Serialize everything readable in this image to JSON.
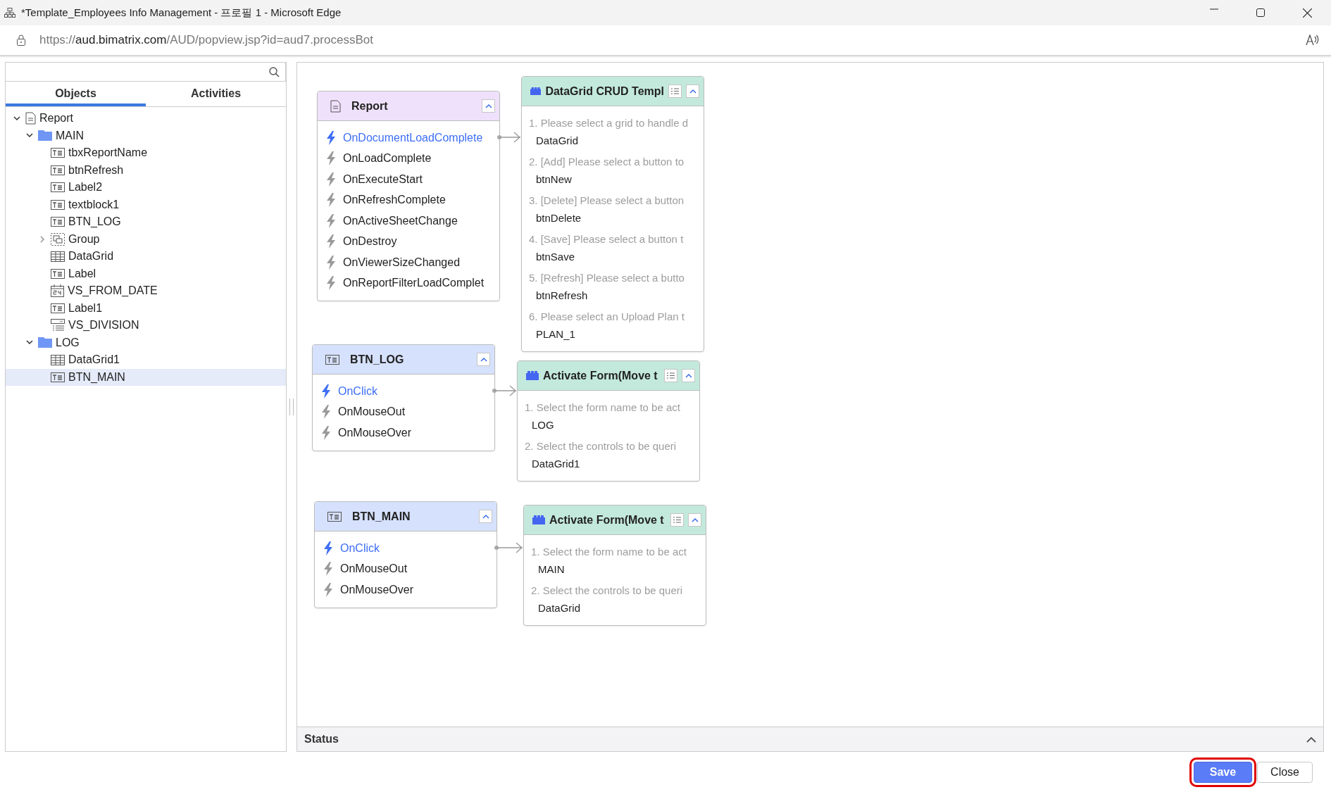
{
  "window": {
    "title": "*Template_Employees Info Management - 프로필 1 - Microsoft Edge"
  },
  "address_bar": {
    "url": "https://**aud.bimatrix.com**/AUD/popview.jsp?id=aud7.processBot"
  },
  "sidebar": {
    "tabs": [
      {
        "label": "Objects",
        "selected": true
      },
      {
        "label": "Activities",
        "selected": false
      }
    ],
    "tree": [
      {
        "label": "Report",
        "kind": "report",
        "expanded": true,
        "selected": false,
        "children": [
          {
            "label": "MAIN",
            "kind": "folder",
            "expanded": true,
            "selected": false,
            "children": [
              {
                "label": "tbxReportName",
                "kind": "textbox",
                "selected": false
              },
              {
                "label": "btnRefresh",
                "kind": "textbox",
                "selected": false
              },
              {
                "label": "Label2",
                "kind": "textbox",
                "selected": false
              },
              {
                "label": "textblock1",
                "kind": "textbox",
                "selected": false
              },
              {
                "label": "BTN_LOG",
                "kind": "textbox",
                "selected": false
              },
              {
                "label": "Group",
                "kind": "group",
                "expanded": false,
                "selected": false
              },
              {
                "label": "DataGrid",
                "kind": "grid",
                "selected": false
              },
              {
                "label": "Label",
                "kind": "textbox",
                "selected": false
              },
              {
                "label": "VS_FROM_DATE",
                "kind": "date",
                "selected": false
              },
              {
                "label": "Label1",
                "kind": "textbox",
                "selected": false
              },
              {
                "label": "VS_DIVISION",
                "kind": "combo",
                "selected": false
              }
            ]
          },
          {
            "label": "LOG",
            "kind": "folder",
            "expanded": true,
            "selected": false,
            "children": [
              {
                "label": "DataGrid1",
                "kind": "grid",
                "selected": false
              },
              {
                "label": "BTN_MAIN",
                "kind": "textbox",
                "selected": true
              }
            ]
          }
        ]
      }
    ]
  },
  "canvas": {
    "flows": [
      {
        "trigger": {
          "title": "Report",
          "kind": "report",
          "events": [
            {
              "label": "OnDocumentLoadComplete",
              "active": true
            },
            {
              "label": "OnLoadComplete",
              "active": false
            },
            {
              "label": "OnExecuteStart",
              "active": false
            },
            {
              "label": "OnRefreshComplete",
              "active": false
            },
            {
              "label": "OnActiveSheetChange",
              "active": false
            },
            {
              "label": "OnDestroy",
              "active": false
            },
            {
              "label": "OnViewerSizeChanged",
              "active": false
            },
            {
              "label": "OnReportFilterLoadComplet",
              "active": false
            }
          ]
        },
        "action": {
          "title": "DataGrid CRUD Templ",
          "params": [
            {
              "label": "1. Please select a grid to handle d",
              "value": "DataGrid"
            },
            {
              "label": "2. [Add] Please select a button to",
              "value": "btnNew"
            },
            {
              "label": "3. [Delete] Please select a button",
              "value": "btnDelete"
            },
            {
              "label": "4. [Save] Please select a button t",
              "value": "btnSave"
            },
            {
              "label": "5. [Refresh] Please select a butto",
              "value": "btnRefresh"
            },
            {
              "label": "6. Please select an Upload Plan t",
              "value": "PLAN_1"
            }
          ]
        }
      },
      {
        "trigger": {
          "title": "BTN_LOG",
          "kind": "textbox",
          "events": [
            {
              "label": "OnClick",
              "active": true
            },
            {
              "label": "OnMouseOut",
              "active": false
            },
            {
              "label": "OnMouseOver",
              "active": false
            }
          ]
        },
        "action": {
          "title": "Activate Form(Move t",
          "params": [
            {
              "label": "1. Select the form name to be act",
              "value": "LOG"
            },
            {
              "label": "2. Select the controls to be queri",
              "value": "DataGrid1"
            }
          ]
        }
      },
      {
        "trigger": {
          "title": "BTN_MAIN",
          "kind": "textbox",
          "events": [
            {
              "label": "OnClick",
              "active": true
            },
            {
              "label": "OnMouseOut",
              "active": false
            },
            {
              "label": "OnMouseOver",
              "active": false
            }
          ]
        },
        "action": {
          "title": "Activate Form(Move t",
          "params": [
            {
              "label": "1. Select the form name to be act",
              "value": "MAIN"
            },
            {
              "label": "2. Select the controls to be queri",
              "value": "DataGrid"
            }
          ]
        }
      }
    ]
  },
  "status_panel": {
    "title": "Status"
  },
  "buttons": [
    {
      "label": "Save",
      "kind": "primary",
      "highlighted": true
    },
    {
      "label": "Close",
      "kind": "secondary",
      "highlighted": false
    }
  ]
}
